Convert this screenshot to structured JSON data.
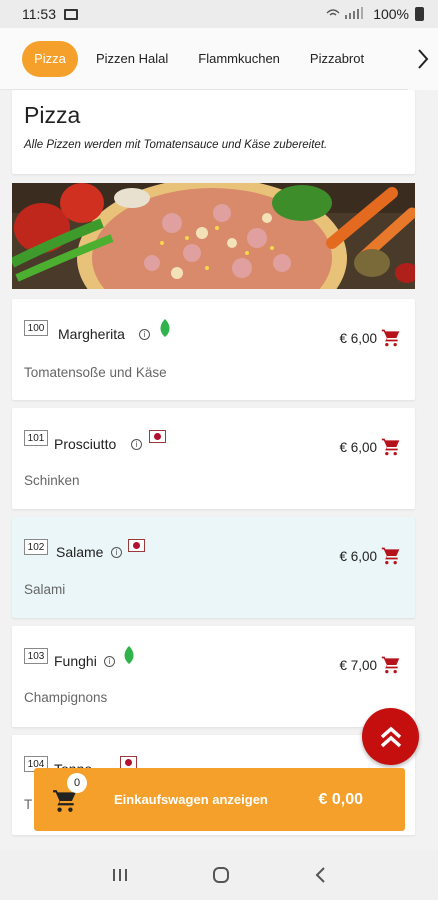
{
  "status_bar": {
    "time": "11:53",
    "battery": "100%"
  },
  "tabs": [
    {
      "label": "Pizza",
      "active": true
    },
    {
      "label": "Pizzen Halal",
      "active": false
    },
    {
      "label": "Flammkuchen",
      "active": false
    },
    {
      "label": "Pizzabrot",
      "active": false
    }
  ],
  "category": {
    "title": "Pizza",
    "subtitle": "Alle Pizzen werden mit Tomatensauce und Käse zubereitet."
  },
  "items": [
    {
      "number": "100",
      "name": "Margherita",
      "description": "Tomatensoße und Käse",
      "price": "€ 6,00",
      "badge": "leaf-icon"
    },
    {
      "number": "101",
      "name": "Prosciutto",
      "description": "Schinken",
      "price": "€ 6,00",
      "badge": "flag-icon"
    },
    {
      "number": "102",
      "name": "Salame",
      "description": "Salami",
      "price": "€ 6,00",
      "badge": "flag-icon"
    },
    {
      "number": "103",
      "name": "Funghi",
      "description": "Champignons",
      "price": "€ 7,00",
      "badge": "leaf-icon"
    },
    {
      "number": "104",
      "name": "Tonno",
      "description": "T",
      "price": "",
      "badge": "flag-icon"
    }
  ],
  "cart": {
    "count": "0",
    "label": "Einkaufswagen anzeigen",
    "total": "€ 0,00"
  },
  "colors": {
    "accent": "#f5a02a",
    "fab": "#c50e0e",
    "cart_icon": "#b5121b",
    "leaf": "#2fb34a",
    "highlight_row": "#eaf6f8"
  }
}
